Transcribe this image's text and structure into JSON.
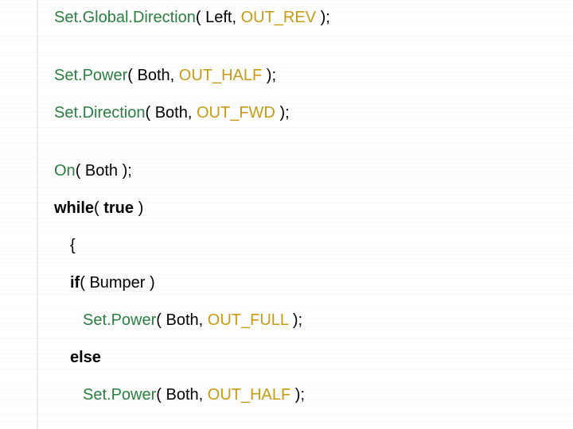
{
  "code": {
    "l1": {
      "fn": "Set.Global.Direction",
      "open": "( ",
      "arg1": "Left",
      "sep": ", ",
      "const": "OUT_REV",
      "close": " );"
    },
    "l2": {
      "fn": "Set.Power",
      "open": "( ",
      "arg1": "Both",
      "sep": ", ",
      "const": "OUT_HALF",
      "close": " );"
    },
    "l3": {
      "fn": "Set.Direction",
      "open": "( ",
      "arg1": "Both",
      "sep": ", ",
      "const": "OUT_FWD",
      "close": " );"
    },
    "l4": {
      "fn": "On",
      "open": "( ",
      "arg1": "Both",
      "close": " );"
    },
    "l5": {
      "kw": "while",
      "open": "( ",
      "arg": "true",
      "close": " )"
    },
    "l6": {
      "brace": "{"
    },
    "l7": {
      "kw": "if",
      "open": "( ",
      "arg": "Bumper",
      "close": " )"
    },
    "l8": {
      "fn": "Set.Power",
      "open": "( ",
      "arg1": "Both",
      "sep": ", ",
      "const": "OUT_FULL",
      "close": " );"
    },
    "l9": {
      "kw": "else"
    },
    "l10": {
      "fn": "Set.Power",
      "open": "( ",
      "arg1": "Both",
      "sep": ", ",
      "const": "OUT_HALF",
      "close": " );"
    }
  }
}
